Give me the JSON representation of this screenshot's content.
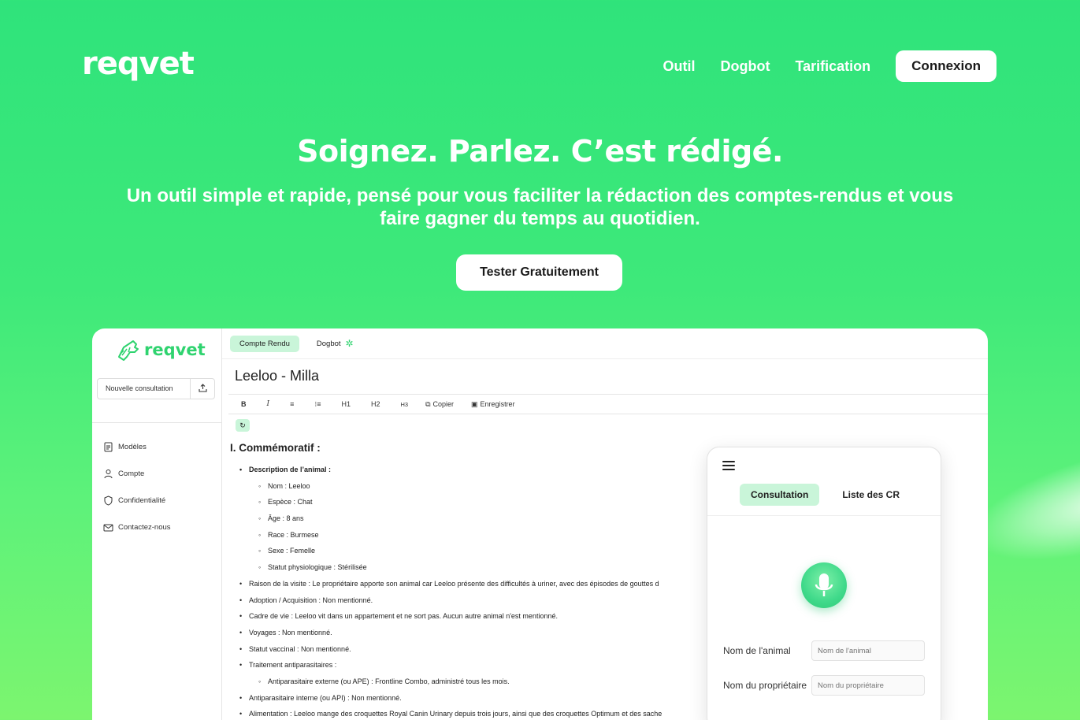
{
  "brand": {
    "logo": "reqvet"
  },
  "nav": {
    "items": [
      "Outil",
      "Dogbot",
      "Tarification"
    ],
    "login": "Connexion"
  },
  "hero": {
    "title": "Soignez. Parlez. C’est rédigé.",
    "subtitle": "Un outil simple et rapide, pensé pour vous faciliter la rédaction des comptes-rendus et vous faire gagner du temps au quotidien.",
    "cta": "Tester Gratuitement"
  },
  "app": {
    "logo": "reqvet",
    "new_consultation": "Nouvelle consultation",
    "sidebar": [
      "Modèles",
      "Compte",
      "Confidentialité",
      "Contactez-nous"
    ],
    "tabs": [
      "Compte Rendu",
      "Dogbot"
    ],
    "doc_title": "Leeloo - Milla",
    "toolbar": {
      "bold": "B",
      "italic": "I",
      "h1": "H1",
      "h2": "H2",
      "h3": "H3",
      "copy": "Copier",
      "save": "Enregistrer"
    },
    "section_title": "I. Commémoratif :",
    "lines": [
      {
        "level": 1,
        "bold": true,
        "text": "Description de l’animal :"
      },
      {
        "level": 2,
        "bold": false,
        "text": "Nom : Leeloo"
      },
      {
        "level": 2,
        "bold": false,
        "text": "Espèce : Chat"
      },
      {
        "level": 2,
        "bold": false,
        "text": "Âge : 8 ans"
      },
      {
        "level": 2,
        "bold": false,
        "text": "Race : Burmese"
      },
      {
        "level": 2,
        "bold": false,
        "text": "Sexe : Femelle"
      },
      {
        "level": 2,
        "bold": false,
        "text": "Statut physiologique : Stérilisée"
      },
      {
        "level": 1,
        "bold": false,
        "text": "Raison de la visite : Le propriétaire apporte son animal car Leeloo présente des difficultés à uriner, avec des épisodes de gouttes d"
      },
      {
        "level": 1,
        "bold": false,
        "text": "Adoption / Acquisition : Non mentionné."
      },
      {
        "level": 1,
        "bold": false,
        "text": "Cadre de vie : Leeloo vit dans un appartement et ne sort pas. Aucun autre animal n'est mentionné."
      },
      {
        "level": 1,
        "bold": false,
        "text": "Voyages : Non mentionné."
      },
      {
        "level": 1,
        "bold": false,
        "text": "Statut vaccinal : Non mentionné."
      },
      {
        "level": 1,
        "bold": false,
        "text": "Traitement antiparasitaires :"
      },
      {
        "level": 2,
        "bold": false,
        "text": "Antiparasitaire externe (ou APE) : Frontline Combo, administré tous les mois."
      },
      {
        "level": 1,
        "bold": false,
        "text": "Antiparasitaire interne (ou API) : Non mentionné."
      },
      {
        "level": 1,
        "bold": false,
        "text": "Alimentation : Leeloo mange des croquettes Royal Canin Urinary depuis trois jours, ainsi que des croquettes Optimum et des sache"
      }
    ]
  },
  "mobile": {
    "tabs": [
      "Consultation",
      "Liste des CR"
    ],
    "fields": [
      {
        "label": "Nom de l'animal",
        "placeholder": "Nom de l'animal"
      },
      {
        "label": "Nom du propriétaire",
        "placeholder": "Nom du propriétaire"
      }
    ]
  },
  "colors": {
    "accent": "#2fe37b",
    "tab_active": "#c9f5d9",
    "logo_green": "#2fd36f"
  }
}
